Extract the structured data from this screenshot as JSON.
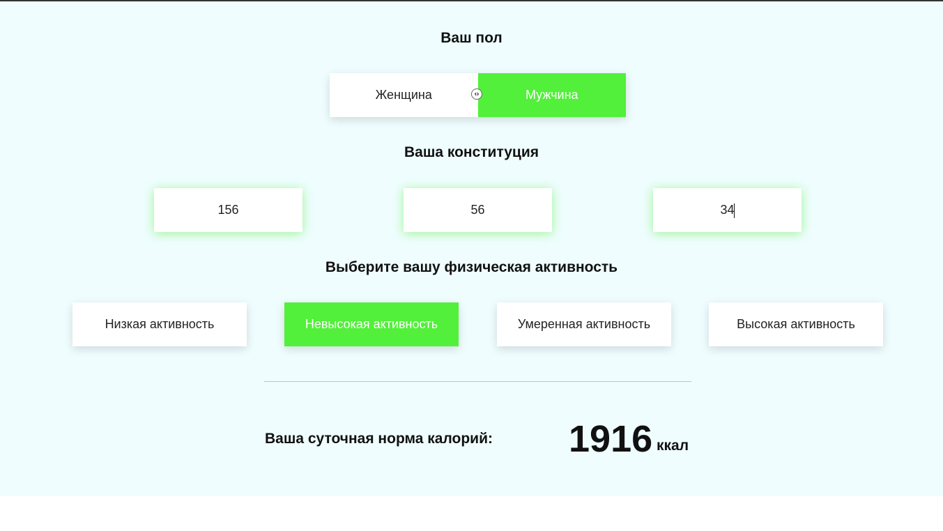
{
  "gender": {
    "heading": "Ваш пол",
    "options": [
      {
        "label": "Женщина",
        "selected": false
      },
      {
        "label": "Мужчина",
        "selected": true
      }
    ]
  },
  "constitution": {
    "heading": "Ваша конституция",
    "height_value": "156",
    "weight_value": "56",
    "age_value": "34"
  },
  "activity": {
    "heading": "Выберите вашу физическая активность",
    "options": [
      {
        "label": "Низкая активность",
        "selected": false
      },
      {
        "label": "Невысокая активность",
        "selected": true
      },
      {
        "label": "Умеренная активность",
        "selected": false
      },
      {
        "label": "Высокая активность",
        "selected": false
      }
    ]
  },
  "result": {
    "label": "Ваша суточная норма калорий:",
    "value": "1916",
    "unit": "ккал"
  },
  "colors": {
    "accent": "#52f03a",
    "background": "#effdfe",
    "text": "#111111"
  },
  "icons": {
    "switch_knob": "switch-arrows-icon"
  }
}
